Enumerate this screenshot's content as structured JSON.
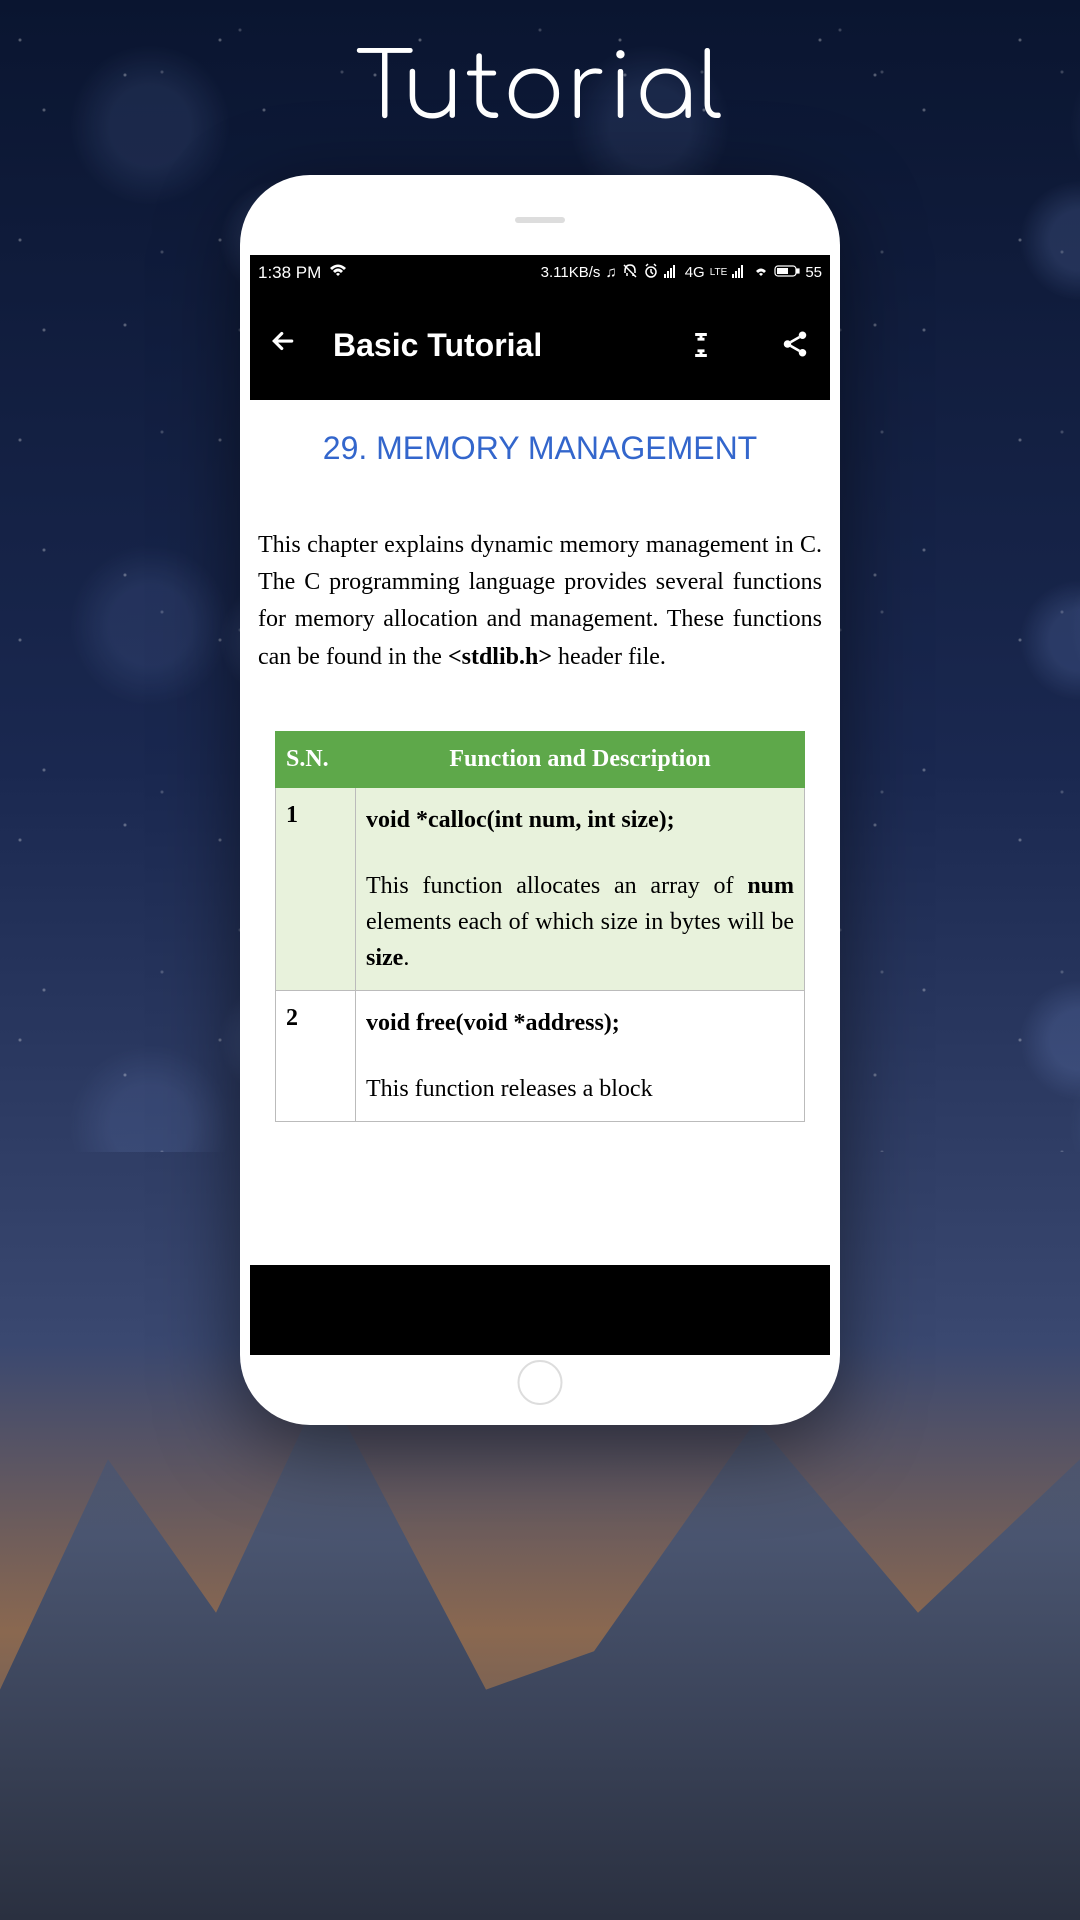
{
  "page": {
    "title": "Tutorial"
  },
  "statusBar": {
    "time": "1:38 PM",
    "netSpeed": "3.11KB/s",
    "networkLabel": "4G",
    "lteLabel": "LTE",
    "batteryPct": "55"
  },
  "appBar": {
    "title": "Basic Tutorial"
  },
  "chapter": {
    "heading": "29. MEMORY MANAGEMENT",
    "paragraph_before": "This chapter explains dynamic memory management in C. The C programming language provides several functions for memory allocation and management. These functions can be found in the ",
    "paragraph_bold": "<stdlib.h>",
    "paragraph_after": " header file."
  },
  "table": {
    "headers": {
      "sn": "S.N.",
      "func": "Function and Description"
    },
    "rows": [
      {
        "sn": "1",
        "signature": "void *calloc(int num, int size);",
        "desc_parts": [
          "This function allocates an array of ",
          "num",
          " elements each of which size in bytes will be ",
          "size",
          "."
        ]
      },
      {
        "sn": "2",
        "signature": "void free(void *address);",
        "desc_parts": [
          "This function releases a block"
        ]
      }
    ]
  },
  "colors": {
    "heading": "#3366cc",
    "tableHeader": "#5ea84a",
    "rowOdd": "#e8f2dc"
  }
}
